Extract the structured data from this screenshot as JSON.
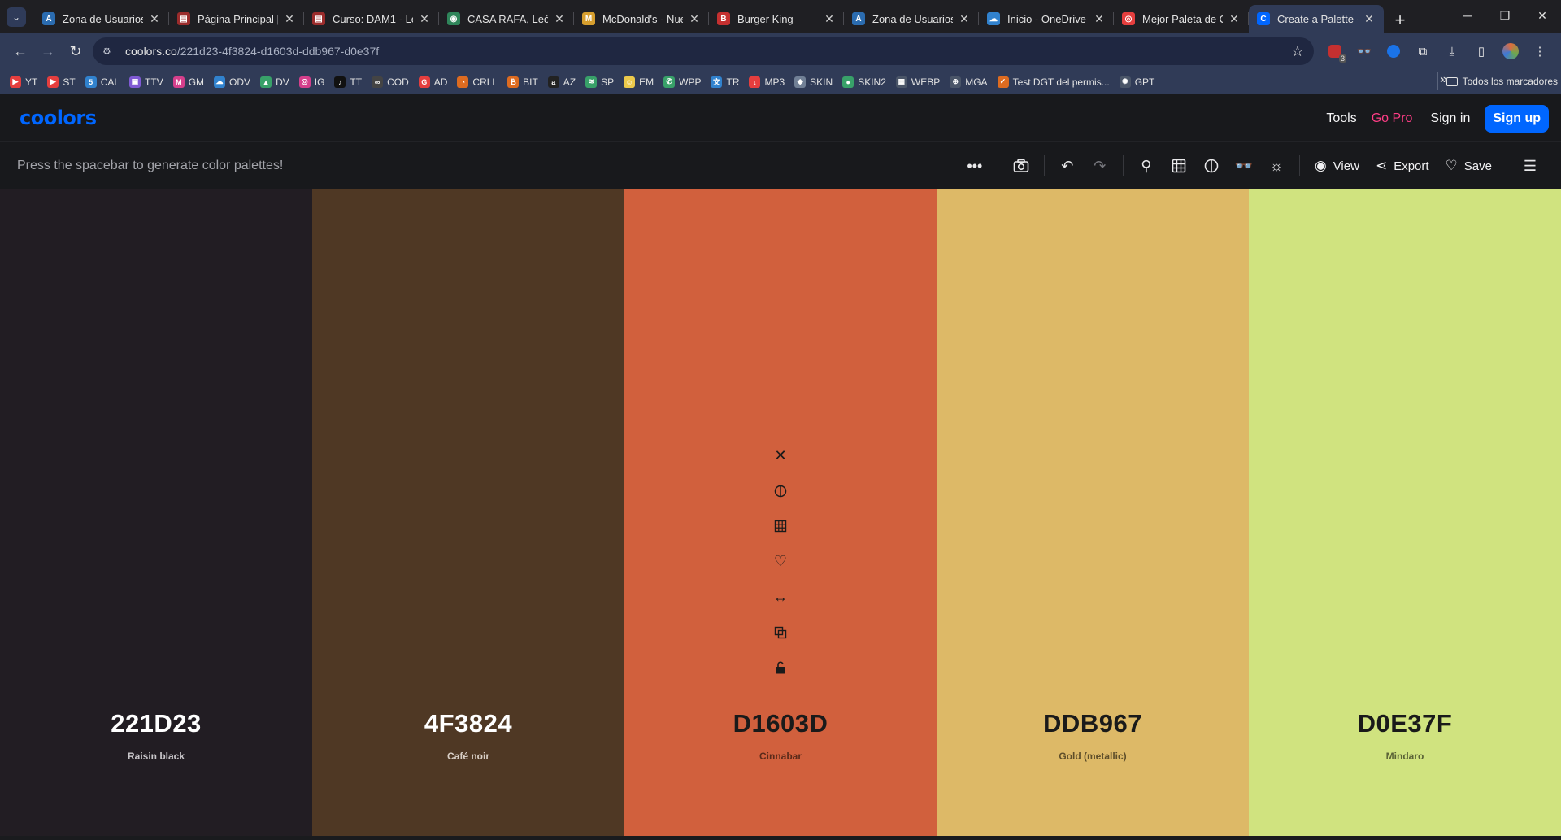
{
  "browser": {
    "tabs": [
      {
        "title": "Zona de Usuarios",
        "favicon_color": "#2b6cb0",
        "favicon": "A"
      },
      {
        "title": "Página Principal |",
        "favicon_color": "#9b2c2c",
        "favicon": "▤"
      },
      {
        "title": "Curso: DAM1 - Le",
        "favicon_color": "#9b2c2c",
        "favicon": "▤"
      },
      {
        "title": "CASA RAFA, León",
        "favicon_color": "#2f855a",
        "favicon": "◉"
      },
      {
        "title": "McDonald's - Nue",
        "favicon_color": "#d69e2e",
        "favicon": "M"
      },
      {
        "title": "Burger King",
        "favicon_color": "#c53030",
        "favicon": "B"
      },
      {
        "title": "Zona de Usuarios",
        "favicon_color": "#2b6cb0",
        "favicon": "A"
      },
      {
        "title": "Inicio - OneDrive",
        "favicon_color": "#3182ce",
        "favicon": "☁"
      },
      {
        "title": "Mejor Paleta de C",
        "favicon_color": "#e53e3e",
        "favicon": "◎"
      },
      {
        "title": "Create a Palette -",
        "favicon_color": "#0066ff",
        "favicon": "C"
      }
    ],
    "url_domain": "coolors.co",
    "url_path": "/221d23-4f3824-d1603d-ddb967-d0e37f",
    "extension_badge": "3",
    "bookmarks": [
      {
        "label": "YT",
        "color": "#e53e3e",
        "icon": "▶"
      },
      {
        "label": "ST",
        "color": "#e53e3e",
        "icon": "▶"
      },
      {
        "label": "CAL",
        "color": "#3182ce",
        "icon": "5"
      },
      {
        "label": "TTV",
        "color": "#805ad5",
        "icon": "▣"
      },
      {
        "label": "GM",
        "color": "#d53f8c",
        "icon": "M"
      },
      {
        "label": "ODV",
        "color": "#3182ce",
        "icon": "☁"
      },
      {
        "label": "DV",
        "color": "#38a169",
        "icon": "▲"
      },
      {
        "label": "IG",
        "color": "#d53f8c",
        "icon": "◎"
      },
      {
        "label": "TT",
        "color": "#111111",
        "icon": "♪"
      },
      {
        "label": "COD",
        "color": "#444444",
        "icon": "∞"
      },
      {
        "label": "AD",
        "color": "#e53e3e",
        "icon": "G"
      },
      {
        "label": "CRLL",
        "color": "#dd6b20",
        "icon": "◔"
      },
      {
        "label": "BIT",
        "color": "#dd6b20",
        "icon": "₿"
      },
      {
        "label": "AZ",
        "color": "#222222",
        "icon": "a"
      },
      {
        "label": "SP",
        "color": "#38a169",
        "icon": "≋"
      },
      {
        "label": "EM",
        "color": "#ecc94b",
        "icon": "☺"
      },
      {
        "label": "WPP",
        "color": "#38a169",
        "icon": "✆"
      },
      {
        "label": "TR",
        "color": "#3182ce",
        "icon": "文"
      },
      {
        "label": "MP3",
        "color": "#e53e3e",
        "icon": "↓"
      },
      {
        "label": "SKIN",
        "color": "#718096",
        "icon": "◆"
      },
      {
        "label": "SKIN2",
        "color": "#38a169",
        "icon": "●"
      },
      {
        "label": "WEBP",
        "color": "#4a5568",
        "icon": "▦"
      },
      {
        "label": "MGA",
        "color": "#4a5568",
        "icon": "⊕"
      },
      {
        "label": "Test DGT del permis...",
        "color": "#dd6b20",
        "icon": "✓"
      },
      {
        "label": "GPT",
        "color": "#4a5568",
        "icon": "✺"
      }
    ],
    "all_bookmarks_label": "Todos los marcadores"
  },
  "header": {
    "logo": "coolors",
    "tools": "Tools",
    "gopro": "Go Pro",
    "signin": "Sign in",
    "signup": "Sign up"
  },
  "subbar": {
    "hint": "Press the spacebar to generate color palettes!",
    "view_label": "View",
    "export_label": "Export",
    "save_label": "Save"
  },
  "palette": [
    {
      "hex": "221D23",
      "name": "Raisin black",
      "color": "#221D23",
      "text_color": "#ffffff",
      "name_color": "#c9c6ca"
    },
    {
      "hex": "4F3824",
      "name": "Café noir",
      "color": "#4F3824",
      "text_color": "#ffffff",
      "name_color": "#d9cfc6"
    },
    {
      "hex": "D1603D",
      "name": "Cinnabar",
      "color": "#D1603D",
      "text_color": "#1a1a1a",
      "name_color": "#5a2a1a"
    },
    {
      "hex": "DDB967",
      "name": "Gold (metallic)",
      "color": "#DDB967",
      "text_color": "#1a1a1a",
      "name_color": "#5e4e2a"
    },
    {
      "hex": "D0E37F",
      "name": "Mindaro",
      "color": "#D0E37F",
      "text_color": "#1a1a1a",
      "name_color": "#5a6236"
    }
  ]
}
